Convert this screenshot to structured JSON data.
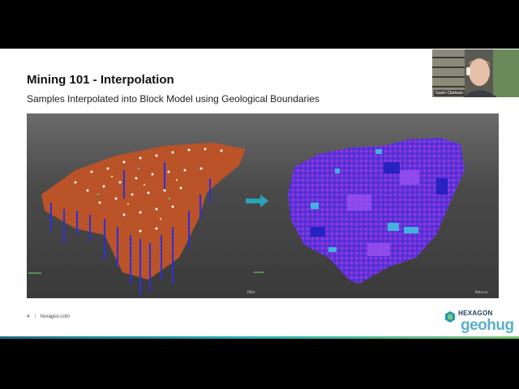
{
  "slide": {
    "title": "Mining 101 - Interpolation",
    "subtitle": "Samples Interpolated into Block Model using Geological Boundaries",
    "viewport": {
      "left_label": "Filter",
      "right_label": "Returns"
    },
    "footer": {
      "page_number": "4",
      "separator": "|",
      "url": "hexagon.com"
    },
    "logo": {
      "brand": "HEXAGON",
      "event": "geohug"
    }
  },
  "webcam": {
    "name": "Gavin Clarkson"
  },
  "colors": {
    "accent": "#2db0b0",
    "block_model_purple": "#7a35d8",
    "drillhole_orange": "#c65a2a",
    "arrow": "#2aa3b5"
  }
}
